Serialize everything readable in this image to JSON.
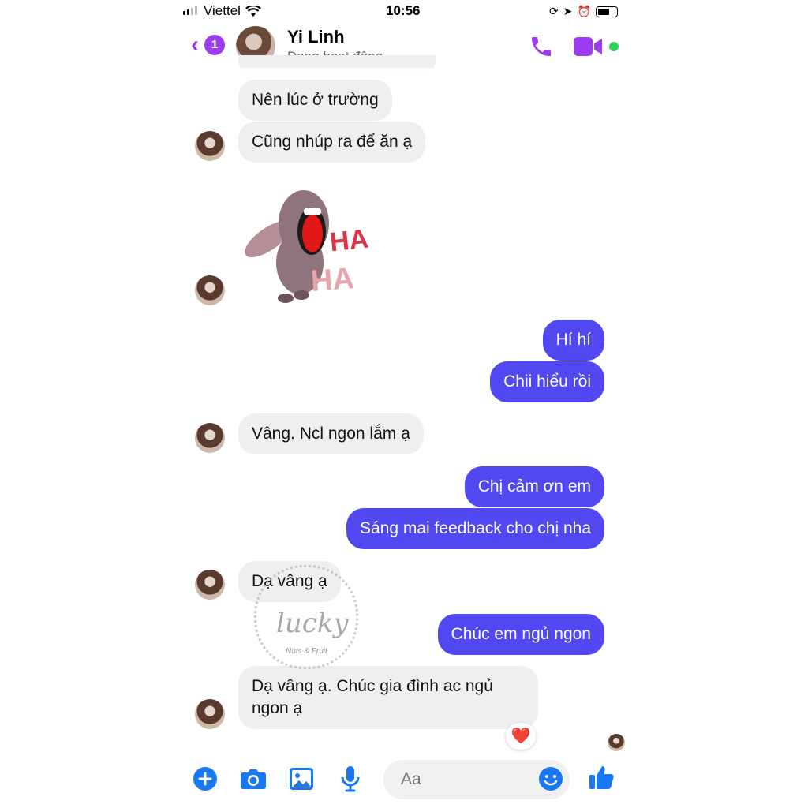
{
  "status_bar": {
    "carrier": "Viettel",
    "time": "10:56"
  },
  "header": {
    "unread_count": "1",
    "contact_name": "Yi Linh",
    "contact_status": "Đang hoạt động"
  },
  "messages": [
    {
      "side": "left",
      "text": "Nên lúc ở trường"
    },
    {
      "side": "left",
      "text": "Cũng nhúp ra để ăn ạ"
    },
    {
      "side": "left",
      "sticker": "laughing-donkey-sticker",
      "sticker_text": [
        "HA",
        "HA"
      ]
    },
    {
      "side": "right",
      "text": "Hí hí"
    },
    {
      "side": "right",
      "text": "Chii hiểu rồi"
    },
    {
      "side": "left",
      "text": "Vâng. Ncl ngon lắm ạ"
    },
    {
      "side": "right",
      "text": "Chị cảm ơn em"
    },
    {
      "side": "right",
      "text": "Sáng mai feedback cho chị nha"
    },
    {
      "side": "left",
      "text": "Dạ vâng ạ"
    },
    {
      "side": "right",
      "text": "Chúc em ngủ ngon"
    },
    {
      "side": "left",
      "text": "Dạ vâng ạ. Chúc gia đình ac ngủ ngon ạ",
      "reaction": "❤️"
    }
  ],
  "watermark": {
    "brand": "lucky",
    "tagline": "Nuts & Fruit"
  },
  "composer": {
    "placeholder": "Aa"
  },
  "colors": {
    "accent": "#9b3cf0",
    "outgoing_bubble": "#5148f2",
    "incoming_bubble": "#efefef",
    "toolbar_blue": "#1877f2",
    "online_dot": "#31d158"
  },
  "icons": [
    "back-chevron-icon",
    "phone-icon",
    "video-camera-icon",
    "add-icon",
    "camera-icon",
    "image-icon",
    "microphone-icon",
    "emoji-icon",
    "thumbs-up-icon"
  ]
}
